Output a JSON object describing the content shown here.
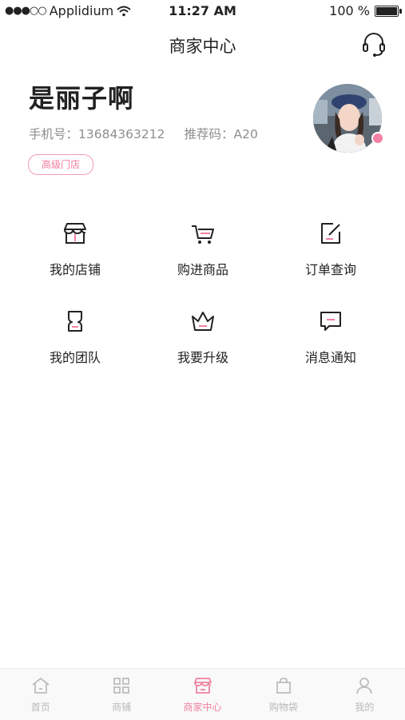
{
  "status_bar": {
    "carrier": "Applidium",
    "time": "11:27 AM",
    "battery": "100 %",
    "battery_level": 1.0
  },
  "nav": {
    "title": "商家中心",
    "support_icon": "headset-icon"
  },
  "profile": {
    "name": "是丽子啊",
    "phone_label": "手机号：13684363212",
    "referral_label": "推荐码：A20",
    "level_badge": "高级门店"
  },
  "menu": [
    {
      "label": "我的店铺",
      "icon": "store-icon"
    },
    {
      "label": "购进商品",
      "icon": "cart-icon"
    },
    {
      "label": "订单查询",
      "icon": "edit-note-icon"
    },
    {
      "label": "我的团队",
      "icon": "team-icon"
    },
    {
      "label": "我要升级",
      "icon": "crown-icon"
    },
    {
      "label": "消息通知",
      "icon": "message-icon"
    }
  ],
  "tabbar": [
    {
      "label": "首页",
      "icon": "home-icon",
      "active": false
    },
    {
      "label": "商铺",
      "icon": "grid-icon",
      "active": false
    },
    {
      "label": "商家中心",
      "icon": "store-center-icon",
      "active": true
    },
    {
      "label": "购物袋",
      "icon": "bag-icon",
      "active": false
    },
    {
      "label": "我的",
      "icon": "person-icon",
      "active": false
    }
  ],
  "colors": {
    "accent": "#f0829f",
    "text_primary": "#222222",
    "text_secondary": "#8e8e8e",
    "tab_inactive": "#b9b9b9"
  }
}
